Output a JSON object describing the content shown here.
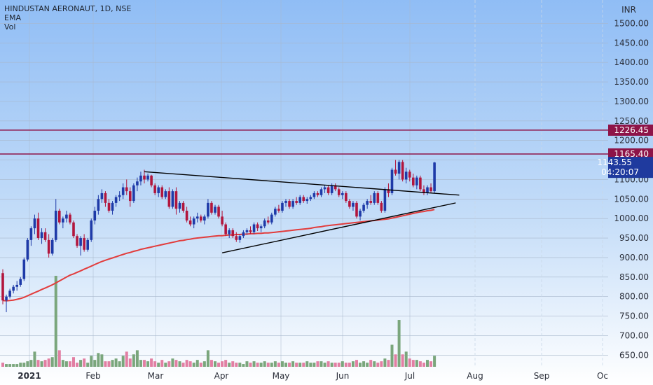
{
  "header": {
    "symbol": "HINDUSTAN AERONAUT, 1D, NSE",
    "indicators": [
      "EMA",
      "Vol"
    ],
    "currency": "INR"
  },
  "colors": {
    "up": "#1e3aa8",
    "down": "#b2163d",
    "ema": "#e23c3c",
    "trendline": "#000000",
    "resistance": "#8e1448",
    "vol_up": "#7aa67c",
    "vol_down": "#e27fa3",
    "last_price_tag": "#1f3a9e",
    "grid": "#a8b8cc"
  },
  "chart_data": {
    "type": "candlestick",
    "x_axis": {
      "ticks": [
        "2021",
        "Feb",
        "Mar",
        "Apr",
        "May",
        "Jun",
        "Jul",
        "Aug",
        "Sep",
        "Oc"
      ]
    },
    "y_axis": {
      "ticks": [
        650,
        700,
        750,
        800,
        850,
        900,
        950,
        1000,
        1050,
        1100,
        1150,
        1200,
        1250,
        1300,
        1350,
        1400,
        1450,
        1500
      ],
      "range": [
        620,
        1560
      ],
      "grid": true
    },
    "candles_ohlc": [
      [
        860,
        870,
        780,
        790
      ],
      [
        790,
        805,
        760,
        800
      ],
      [
        800,
        820,
        795,
        815
      ],
      [
        815,
        830,
        808,
        825
      ],
      [
        825,
        840,
        815,
        830
      ],
      [
        830,
        850,
        825,
        845
      ],
      [
        845,
        900,
        840,
        895
      ],
      [
        895,
        950,
        890,
        945
      ],
      [
        945,
        980,
        930,
        975
      ],
      [
        975,
        1010,
        960,
        1000
      ],
      [
        1000,
        1015,
        945,
        950
      ],
      [
        950,
        975,
        935,
        965
      ],
      [
        965,
        975,
        940,
        945
      ],
      [
        945,
        960,
        900,
        910
      ],
      [
        910,
        950,
        905,
        945
      ],
      [
        945,
        1050,
        940,
        1020
      ],
      [
        1020,
        1025,
        985,
        990
      ],
      [
        990,
        1005,
        975,
        1000
      ],
      [
        1000,
        1020,
        990,
        1010
      ],
      [
        1010,
        1015,
        985,
        990
      ],
      [
        990,
        995,
        950,
        955
      ],
      [
        955,
        960,
        925,
        930
      ],
      [
        930,
        955,
        905,
        950
      ],
      [
        950,
        960,
        915,
        920
      ],
      [
        920,
        950,
        915,
        945
      ],
      [
        945,
        1000,
        940,
        995
      ],
      [
        995,
        1030,
        985,
        1020
      ],
      [
        1020,
        1060,
        1010,
        1050
      ],
      [
        1050,
        1075,
        1040,
        1065
      ],
      [
        1065,
        1070,
        1030,
        1040
      ],
      [
        1040,
        1050,
        1015,
        1020
      ],
      [
        1020,
        1045,
        1010,
        1040
      ],
      [
        1040,
        1060,
        1030,
        1055
      ],
      [
        1055,
        1070,
        1045,
        1060
      ],
      [
        1060,
        1090,
        1050,
        1080
      ],
      [
        1080,
        1100,
        1060,
        1070
      ],
      [
        1070,
        1080,
        1030,
        1045
      ],
      [
        1045,
        1090,
        1040,
        1085
      ],
      [
        1085,
        1105,
        1070,
        1095
      ],
      [
        1095,
        1120,
        1085,
        1110
      ],
      [
        1110,
        1125,
        1090,
        1100
      ],
      [
        1100,
        1115,
        1095,
        1110
      ],
      [
        1110,
        1112,
        1080,
        1085
      ],
      [
        1085,
        1090,
        1060,
        1065
      ],
      [
        1065,
        1085,
        1055,
        1080
      ],
      [
        1080,
        1085,
        1050,
        1055
      ],
      [
        1055,
        1075,
        1050,
        1070
      ],
      [
        1070,
        1080,
        1025,
        1030
      ],
      [
        1030,
        1075,
        1025,
        1070
      ],
      [
        1070,
        1080,
        1010,
        1025
      ],
      [
        1025,
        1045,
        1015,
        1040
      ],
      [
        1040,
        1045,
        1015,
        1020
      ],
      [
        1020,
        1030,
        990,
        995
      ],
      [
        995,
        1005,
        980,
        985
      ],
      [
        985,
        1005,
        975,
        1000
      ],
      [
        1000,
        1015,
        990,
        1005
      ],
      [
        1005,
        1010,
        990,
        995
      ],
      [
        995,
        1010,
        985,
        1005
      ],
      [
        1005,
        1050,
        1000,
        1040
      ],
      [
        1040,
        1045,
        1010,
        1015
      ],
      [
        1015,
        1035,
        1010,
        1030
      ],
      [
        1030,
        1035,
        1000,
        1005
      ],
      [
        1005,
        1020,
        980,
        985
      ],
      [
        985,
        990,
        955,
        960
      ],
      [
        960,
        975,
        950,
        970
      ],
      [
        970,
        975,
        950,
        955
      ],
      [
        955,
        965,
        940,
        945
      ],
      [
        945,
        960,
        938,
        955
      ],
      [
        955,
        970,
        950,
        965
      ],
      [
        965,
        975,
        958,
        970
      ],
      [
        970,
        980,
        960,
        965
      ],
      [
        965,
        990,
        960,
        985
      ],
      [
        985,
        990,
        968,
        975
      ],
      [
        975,
        985,
        965,
        980
      ],
      [
        980,
        1000,
        975,
        995
      ],
      [
        995,
        1005,
        985,
        990
      ],
      [
        990,
        1015,
        985,
        1010
      ],
      [
        1010,
        1030,
        1005,
        1025
      ],
      [
        1025,
        1035,
        1015,
        1020
      ],
      [
        1020,
        1045,
        1015,
        1040
      ],
      [
        1040,
        1050,
        1030,
        1045
      ],
      [
        1045,
        1050,
        1025,
        1030
      ],
      [
        1030,
        1050,
        1025,
        1045
      ],
      [
        1045,
        1055,
        1035,
        1040
      ],
      [
        1040,
        1060,
        1035,
        1055
      ],
      [
        1055,
        1060,
        1040,
        1045
      ],
      [
        1045,
        1055,
        1038,
        1050
      ],
      [
        1050,
        1060,
        1045,
        1055
      ],
      [
        1055,
        1070,
        1050,
        1065
      ],
      [
        1065,
        1070,
        1055,
        1060
      ],
      [
        1060,
        1080,
        1055,
        1075
      ],
      [
        1075,
        1085,
        1065,
        1080
      ],
      [
        1080,
        1085,
        1060,
        1065
      ],
      [
        1065,
        1090,
        1060,
        1085
      ],
      [
        1085,
        1090,
        1070,
        1075
      ],
      [
        1075,
        1080,
        1055,
        1060
      ],
      [
        1060,
        1070,
        1050,
        1065
      ],
      [
        1065,
        1070,
        1040,
        1045
      ],
      [
        1045,
        1050,
        1025,
        1030
      ],
      [
        1030,
        1045,
        1020,
        1040
      ],
      [
        1040,
        1045,
        1000,
        1005
      ],
      [
        1005,
        1025,
        995,
        1020
      ],
      [
        1020,
        1040,
        1015,
        1035
      ],
      [
        1035,
        1050,
        1025,
        1045
      ],
      [
        1045,
        1060,
        1035,
        1040
      ],
      [
        1040,
        1070,
        1035,
        1065
      ],
      [
        1065,
        1070,
        1035,
        1040
      ],
      [
        1040,
        1045,
        1015,
        1020
      ],
      [
        1020,
        1080,
        1015,
        1075
      ],
      [
        1075,
        1090,
        1055,
        1065
      ],
      [
        1065,
        1130,
        1060,
        1125
      ],
      [
        1125,
        1150,
        1110,
        1115
      ],
      [
        1115,
        1150,
        1100,
        1145
      ],
      [
        1145,
        1150,
        1095,
        1100
      ],
      [
        1100,
        1130,
        1090,
        1120
      ],
      [
        1120,
        1125,
        1095,
        1105
      ],
      [
        1105,
        1115,
        1080,
        1085
      ],
      [
        1085,
        1110,
        1075,
        1105
      ],
      [
        1105,
        1110,
        1070,
        1075
      ],
      [
        1075,
        1085,
        1060,
        1065
      ],
      [
        1065,
        1085,
        1060,
        1080
      ],
      [
        1080,
        1090,
        1065,
        1070
      ],
      [
        1070,
        1145,
        1065,
        1143.55
      ]
    ],
    "volume": [
      0.3,
      0.2,
      0.2,
      0.2,
      0.2,
      0.3,
      0.3,
      0.4,
      0.5,
      1.1,
      0.5,
      0.4,
      0.5,
      0.6,
      0.7,
      6.6,
      1.2,
      0.5,
      0.4,
      0.4,
      0.7,
      0.3,
      0.5,
      0.6,
      0.3,
      0.8,
      0.5,
      1.0,
      0.9,
      0.4,
      0.4,
      0.5,
      0.6,
      0.4,
      0.8,
      1.1,
      0.6,
      0.9,
      1.2,
      0.5,
      0.5,
      0.4,
      0.6,
      0.4,
      0.3,
      0.5,
      0.3,
      0.4,
      0.6,
      0.5,
      0.4,
      0.3,
      0.5,
      0.4,
      0.3,
      0.5,
      0.3,
      0.4,
      1.2,
      0.5,
      0.4,
      0.3,
      0.4,
      0.5,
      0.3,
      0.4,
      0.3,
      0.3,
      0.2,
      0.4,
      0.3,
      0.4,
      0.3,
      0.3,
      0.4,
      0.3,
      0.3,
      0.4,
      0.3,
      0.4,
      0.3,
      0.3,
      0.4,
      0.3,
      0.3,
      0.3,
      0.4,
      0.3,
      0.3,
      0.4,
      0.4,
      0.3,
      0.4,
      0.3,
      0.3,
      0.3,
      0.4,
      0.3,
      0.3,
      0.4,
      0.5,
      0.3,
      0.4,
      0.3,
      0.5,
      0.4,
      0.3,
      0.4,
      0.6,
      0.5,
      1.6,
      0.9,
      3.4,
      0.9,
      1.1,
      0.6,
      0.5,
      0.5,
      0.4,
      0.3,
      0.5,
      0.4,
      0.8
    ],
    "ema": [
      790,
      789,
      790,
      791,
      793,
      795,
      798,
      802,
      806,
      810,
      814,
      818,
      822,
      826,
      830,
      835,
      840,
      845,
      850,
      855,
      858,
      862,
      866,
      870,
      874,
      878,
      882,
      886,
      890,
      893,
      896,
      899,
      902,
      905,
      908,
      911,
      913,
      916,
      918,
      921,
      923,
      925,
      927,
      929,
      931,
      933,
      935,
      937,
      939,
      941,
      943,
      944,
      946,
      947,
      949,
      950,
      951,
      952,
      953,
      954,
      955,
      956,
      956,
      957,
      958,
      958,
      959,
      959,
      960,
      960,
      961,
      961,
      962,
      962,
      963,
      963,
      964,
      965,
      966,
      967,
      968,
      969,
      970,
      971,
      972,
      973,
      974,
      975,
      977,
      978,
      979,
      981,
      982,
      983,
      984,
      985,
      986,
      987,
      988,
      989,
      990,
      991,
      992,
      993,
      994,
      995,
      996,
      997,
      998,
      999,
      1001,
      1003,
      1005,
      1007,
      1009,
      1011,
      1013,
      1015,
      1017,
      1018,
      1020,
      1021,
      1023
    ],
    "trendlines": [
      {
        "from": {
          "bar": 40,
          "value": 1120
        },
        "to": {
          "bar": 129,
          "value": 1060
        }
      },
      {
        "from": {
          "bar": 62,
          "value": 912
        },
        "to": {
          "bar": 128,
          "value": 1040
        }
      }
    ],
    "horizontal_levels": [
      {
        "value": 1226.45,
        "label": "1226.45"
      },
      {
        "value": 1165.4,
        "label": "1165.40"
      }
    ],
    "last_price": {
      "value": 1143.55,
      "label": "1143.55",
      "countdown": "04:20:07"
    },
    "legend": "top-left"
  }
}
